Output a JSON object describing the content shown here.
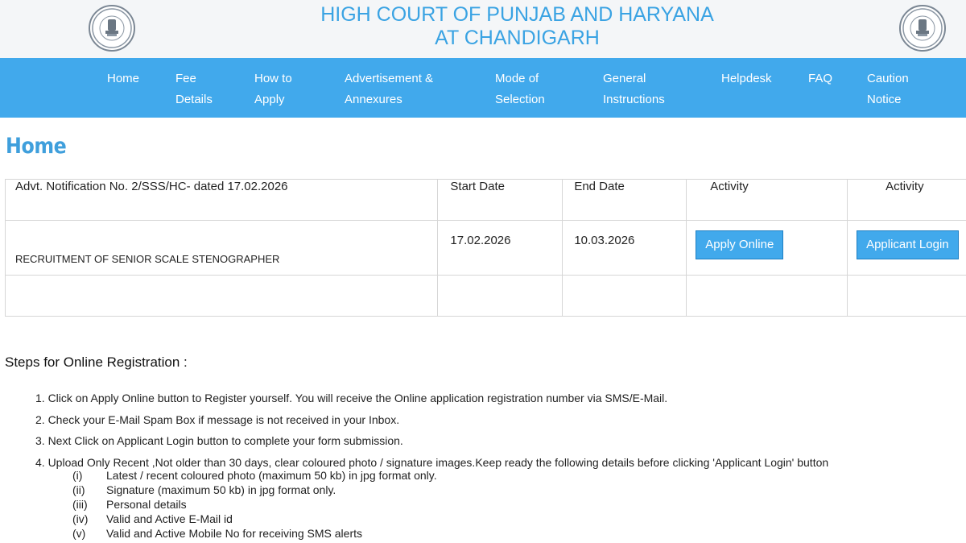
{
  "header": {
    "title_line1": "HIGH COURT OF PUNJAB AND HARYANA",
    "title_line2": "AT CHANDIGARH",
    "emblem_icon": "state-emblem-icon"
  },
  "colors": {
    "accent": "#41a9ec",
    "title": "#3aa3e3",
    "heading": "#3f9fdc",
    "header_bg": "#f4f6f8"
  },
  "nav": {
    "items": [
      {
        "label": "Home"
      },
      {
        "label": "Fee\nDetails"
      },
      {
        "label": "How to\nApply"
      },
      {
        "label": "Advertisement &\nAnnexures"
      },
      {
        "label": "Mode of\nSelection"
      },
      {
        "label": "General\nInstructions"
      },
      {
        "label": "Helpdesk"
      },
      {
        "label": "FAQ"
      },
      {
        "label": "Caution\nNotice"
      }
    ]
  },
  "page": {
    "heading": "Home"
  },
  "table": {
    "headers": [
      "Advt. Notification No. 2/SSS/HC- dated 17.02.2026",
      "Start Date",
      "End Date",
      "Activity",
      "Activity"
    ],
    "rows": [
      {
        "title": "RECRUITMENT OF  SENIOR SCALE STENOGRAPHER",
        "start_date": "17.02.2026",
        "end_date": "10.03.2026",
        "apply_label": "Apply Online",
        "login_label": "Applicant Login"
      }
    ]
  },
  "steps": {
    "title": "Steps for Online Registration :",
    "items": [
      "1. Click on Apply Online button to Register yourself. You will receive the Online application  registration number via SMS/E-Mail.",
      "2. Check your E-Mail Spam Box if message is not received in your Inbox.",
      "3. Next Click on Applicant Login button to complete your form submission.",
      "4. Upload Only Recent ,Not older than 30 days, clear coloured photo / signature images.Keep ready the following details before clicking 'Applicant Login' button"
    ],
    "sub_items": [
      {
        "num": "(i)",
        "text": "Latest / recent coloured photo (maximum 50 kb) in jpg format only."
      },
      {
        "num": "(ii)",
        "text": "Signature (maximum 50 kb) in jpg format only."
      },
      {
        "num": "(iii)",
        "text": "Personal details"
      },
      {
        "num": "(iv)",
        "text": "Valid and Active E-Mail id"
      },
      {
        "num": "(v)",
        "text": "Valid and Active Mobile No for receiving SMS alerts"
      }
    ]
  }
}
